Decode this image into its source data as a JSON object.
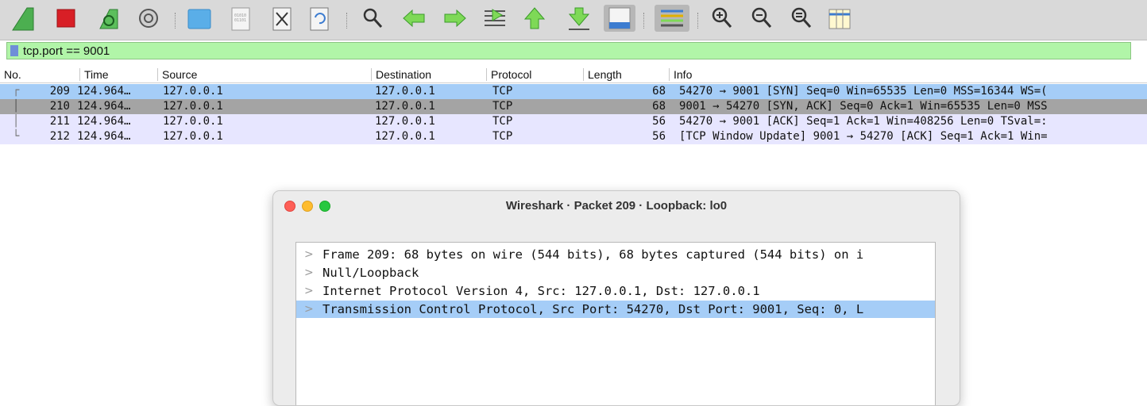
{
  "toolbar": {
    "buttons": [
      {
        "icon": "shark-fin-start-icon"
      },
      {
        "icon": "stop-capture-icon"
      },
      {
        "icon": "restart-capture-icon"
      },
      {
        "icon": "capture-options-icon"
      },
      {
        "icon": "open-file-icon"
      },
      {
        "icon": "save-file-icon"
      },
      {
        "icon": "close-file-icon"
      },
      {
        "icon": "reload-file-icon"
      },
      {
        "icon": "find-packet-icon"
      },
      {
        "icon": "go-back-icon"
      },
      {
        "icon": "go-forward-icon"
      },
      {
        "icon": "go-to-packet-icon"
      },
      {
        "icon": "go-first-packet-icon"
      },
      {
        "icon": "go-last-packet-icon"
      },
      {
        "icon": "auto-scroll-icon"
      },
      {
        "icon": "colorize-icon"
      },
      {
        "icon": "zoom-in-icon"
      },
      {
        "icon": "zoom-out-icon"
      },
      {
        "icon": "normal-size-icon"
      },
      {
        "icon": "resize-columns-icon"
      }
    ]
  },
  "filter": {
    "value": "tcp.port == 9001"
  },
  "packet_list": {
    "columns": [
      "No.",
      "Time",
      "Source",
      "Destination",
      "Protocol",
      "Length",
      "Info"
    ],
    "rows": [
      {
        "no": "209",
        "time": "124.964…",
        "source": "127.0.0.1",
        "destination": "127.0.0.1",
        "protocol": "TCP",
        "length": "68",
        "info": "54270 → 9001 [SYN] Seq=0 Win=65535 Len=0 MSS=16344 WS=("
      },
      {
        "no": "210",
        "time": "124.964…",
        "source": "127.0.0.1",
        "destination": "127.0.0.1",
        "protocol": "TCP",
        "length": "68",
        "info": "9001 → 54270 [SYN, ACK] Seq=0 Ack=1 Win=65535 Len=0 MSS"
      },
      {
        "no": "211",
        "time": "124.964…",
        "source": "127.0.0.1",
        "destination": "127.0.0.1",
        "protocol": "TCP",
        "length": "56",
        "info": "54270 → 9001 [ACK] Seq=1 Ack=1 Win=408256 Len=0 TSval=:"
      },
      {
        "no": "212",
        "time": "124.964…",
        "source": "127.0.0.1",
        "destination": "127.0.0.1",
        "protocol": "TCP",
        "length": "56",
        "info": "[TCP Window Update] 9001 → 54270 [ACK] Seq=1 Ack=1 Win="
      }
    ],
    "colors": {
      "selected": "#a5cdf7",
      "highlight": "#a4a4a4",
      "tcp": "#e7e6ff"
    }
  },
  "dialog": {
    "title": "Wireshark · Packet 209 · Loopback: lo0",
    "tree": [
      {
        "caret": ">",
        "text": "Frame 209: 68 bytes on wire (544 bits), 68 bytes captured (544 bits) on i"
      },
      {
        "caret": ">",
        "text": "Null/Loopback"
      },
      {
        "caret": ">",
        "text": "Internet Protocol Version 4, Src: 127.0.0.1, Dst: 127.0.0.1"
      },
      {
        "caret": ">",
        "text": "Transmission Control Protocol, Src Port: 54270, Dst Port: 9001, Seq: 0, L"
      }
    ],
    "selected_color": "#a5cdf7"
  }
}
